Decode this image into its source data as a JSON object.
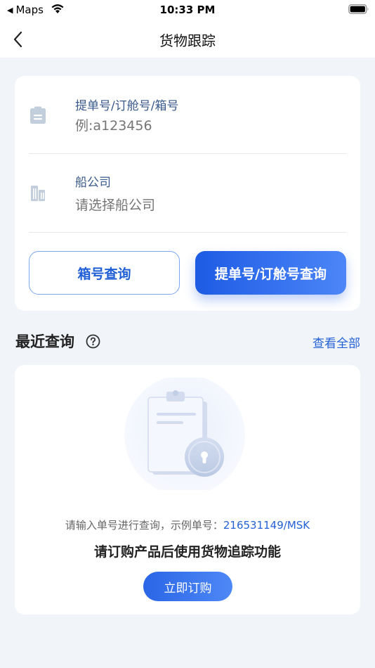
{
  "status_bar": {
    "back_app": "Maps",
    "time": "10:33 PM"
  },
  "nav": {
    "title": "货物跟踪",
    "back_icon": "chevron-left-icon"
  },
  "search": {
    "tracking_field": {
      "label": "提单号/订舱号/箱号",
      "placeholder": "例:a123456",
      "icon": "clipboard-icon"
    },
    "carrier_field": {
      "label": "船公司",
      "placeholder": "请选择船公司",
      "icon": "building-icon"
    },
    "container_query_button": "箱号查询",
    "bl_booking_query_button": "提单号/订舱号查询"
  },
  "recent": {
    "title": "最近查询",
    "view_all": "查看全部",
    "empty": {
      "hint_prefix": "请输入单号进行查询，示例单号：",
      "sample_number": "216531149/MSK",
      "message": "请订购产品后使用货物追踪功能",
      "order_button": "立即订购",
      "illustration": "locked-clipboard-illustration"
    }
  },
  "colors": {
    "accent": "#2462D6",
    "page_bg": "#F1F4F9",
    "label": "#3A5A8C"
  }
}
